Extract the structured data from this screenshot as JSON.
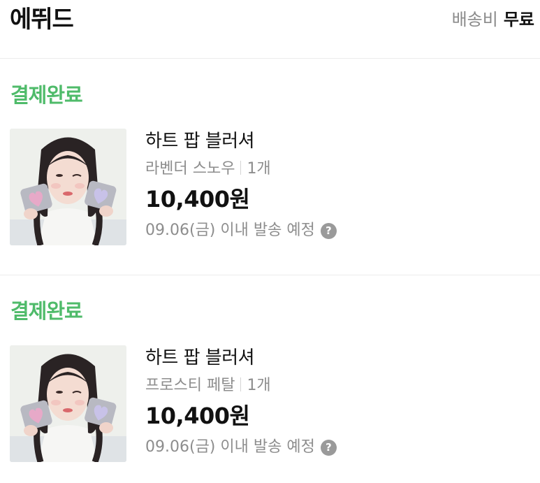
{
  "header": {
    "store_name": "에뛰드",
    "shipping_label": "배송비",
    "shipping_value": "무료"
  },
  "orders": [
    {
      "status": "결제완료",
      "product_name": "하트 팝 블러셔",
      "option": "라벤더 스노우",
      "quantity": "1개",
      "price": "10,400원",
      "ship_date": "09.06(금) 이내 발송 예정",
      "help_icon": "question-icon"
    },
    {
      "status": "결제완료",
      "product_name": "하트 팝 블러셔",
      "option": "프로스티 페탈",
      "quantity": "1개",
      "price": "10,400원",
      "ship_date": "09.06(금) 이내 발송 예정",
      "help_icon": "question-icon"
    }
  ],
  "colors": {
    "status_green": "#4fbb6a",
    "muted_text": "#8d8d8d",
    "divider": "#ececec"
  }
}
